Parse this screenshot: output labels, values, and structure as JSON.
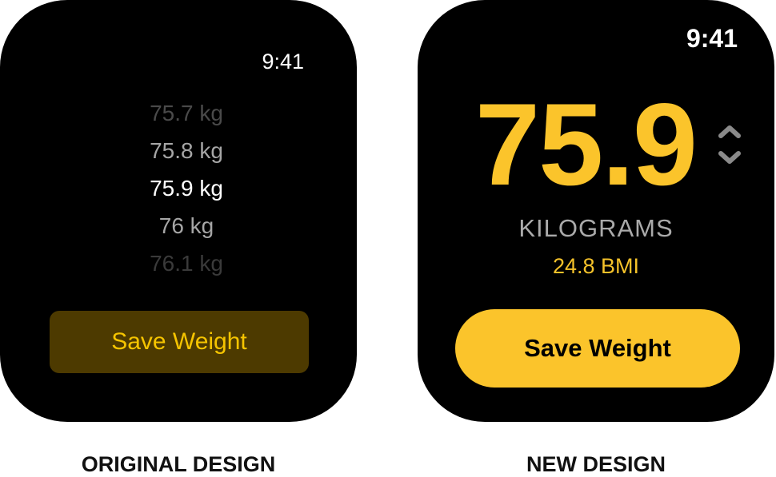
{
  "original": {
    "time": "9:41",
    "picker_items": [
      {
        "label": "75.7 kg",
        "color": "#4a4a4a"
      },
      {
        "label": "75.8 kg",
        "color": "#a6a6a6"
      },
      {
        "label": "75.9 kg",
        "color": "#ffffff"
      },
      {
        "label": "76 kg",
        "color": "#a6a6a6"
      },
      {
        "label": "76.1 kg",
        "color": "#3a3a3a"
      }
    ],
    "save_label": "Save Weight",
    "caption": "ORIGINAL DESIGN"
  },
  "new": {
    "time": "9:41",
    "weight_value": "75.9",
    "unit_label": "KILOGRAMS",
    "bmi_label": "24.8 BMI",
    "stepper_icon": "chevron-up-down-icon",
    "save_label": "Save Weight",
    "caption": "NEW DESIGN"
  },
  "colors": {
    "accent": "#fbc42b",
    "button_dim": "#4d3a00",
    "background": "#000000"
  }
}
